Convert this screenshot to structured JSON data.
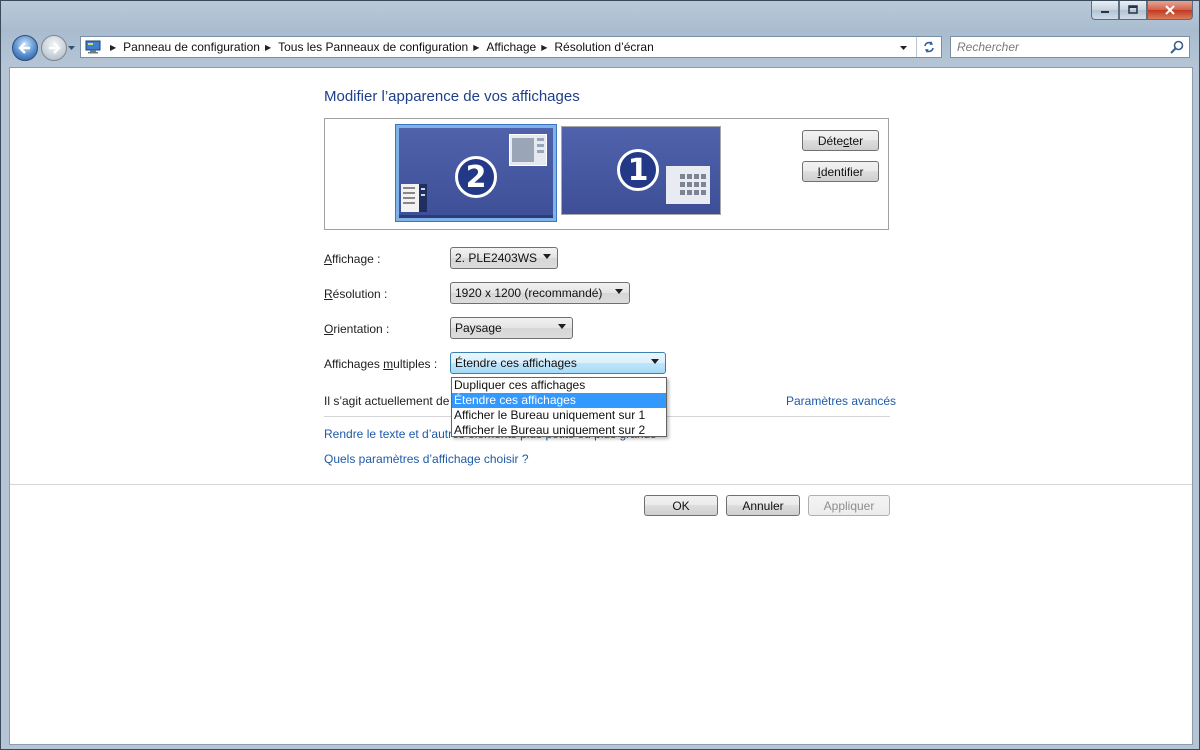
{
  "window": {
    "minimize_glyph": "—",
    "maximize_glyph": "□",
    "close_glyph": "✕"
  },
  "address_bar": {
    "breadcrumbs": [
      {
        "label": "Panneau de configuration"
      },
      {
        "label": "Tous les Panneaux de configuration"
      },
      {
        "label": "Affichage"
      },
      {
        "label": "Résolution d’écran"
      }
    ]
  },
  "search": {
    "placeholder": "Rechercher"
  },
  "page": {
    "heading": "Modifier l’apparence de vos affichages",
    "monitors": [
      {
        "number": "2",
        "selected": true
      },
      {
        "number": "1",
        "selected": false
      }
    ],
    "detect_button": {
      "pre": "Déte",
      "key": "c",
      "post": "ter"
    },
    "identify_button": {
      "pre": "",
      "key": "I",
      "post": "dentifier"
    },
    "fields": {
      "display": {
        "label_key": "A",
        "label_rest": "ffichage :",
        "value": "2. PLE2403WS"
      },
      "resolution": {
        "label_key": "R",
        "label_rest": "ésolution :",
        "value": "1920 x 1200 (recommandé)"
      },
      "orientation": {
        "label_key": "O",
        "label_rest": "rientation :",
        "value": "Paysage"
      },
      "multiple": {
        "label_pre": "Affichages ",
        "label_key": "m",
        "label_rest": "ultiples :",
        "value": "Étendre ces affichages"
      }
    },
    "dropdown_options": [
      {
        "label": "Dupliquer ces affichages",
        "selected": false
      },
      {
        "label": "Étendre ces affichages",
        "selected": true
      },
      {
        "label": "Afficher le Bureau uniquement sur 1",
        "selected": false
      },
      {
        "label": "Afficher le Bureau uniquement sur 2",
        "selected": false
      }
    ],
    "status_text": "Il s’agit actuellement de",
    "advanced_link": "Paramètres avancés",
    "link_text_size": "Rendre le texte et d’autres éléments plus petits ou plus grands",
    "link_which_settings": "Quels paramètres d’affichage choisir ?"
  },
  "footer": {
    "ok": "OK",
    "cancel": "Annuler",
    "apply": "Appliquer"
  },
  "colors": {
    "heading": "#1e3f8b",
    "link": "#1e5aa8",
    "selection": "#3399ff",
    "monitor": "#4a5da6"
  }
}
